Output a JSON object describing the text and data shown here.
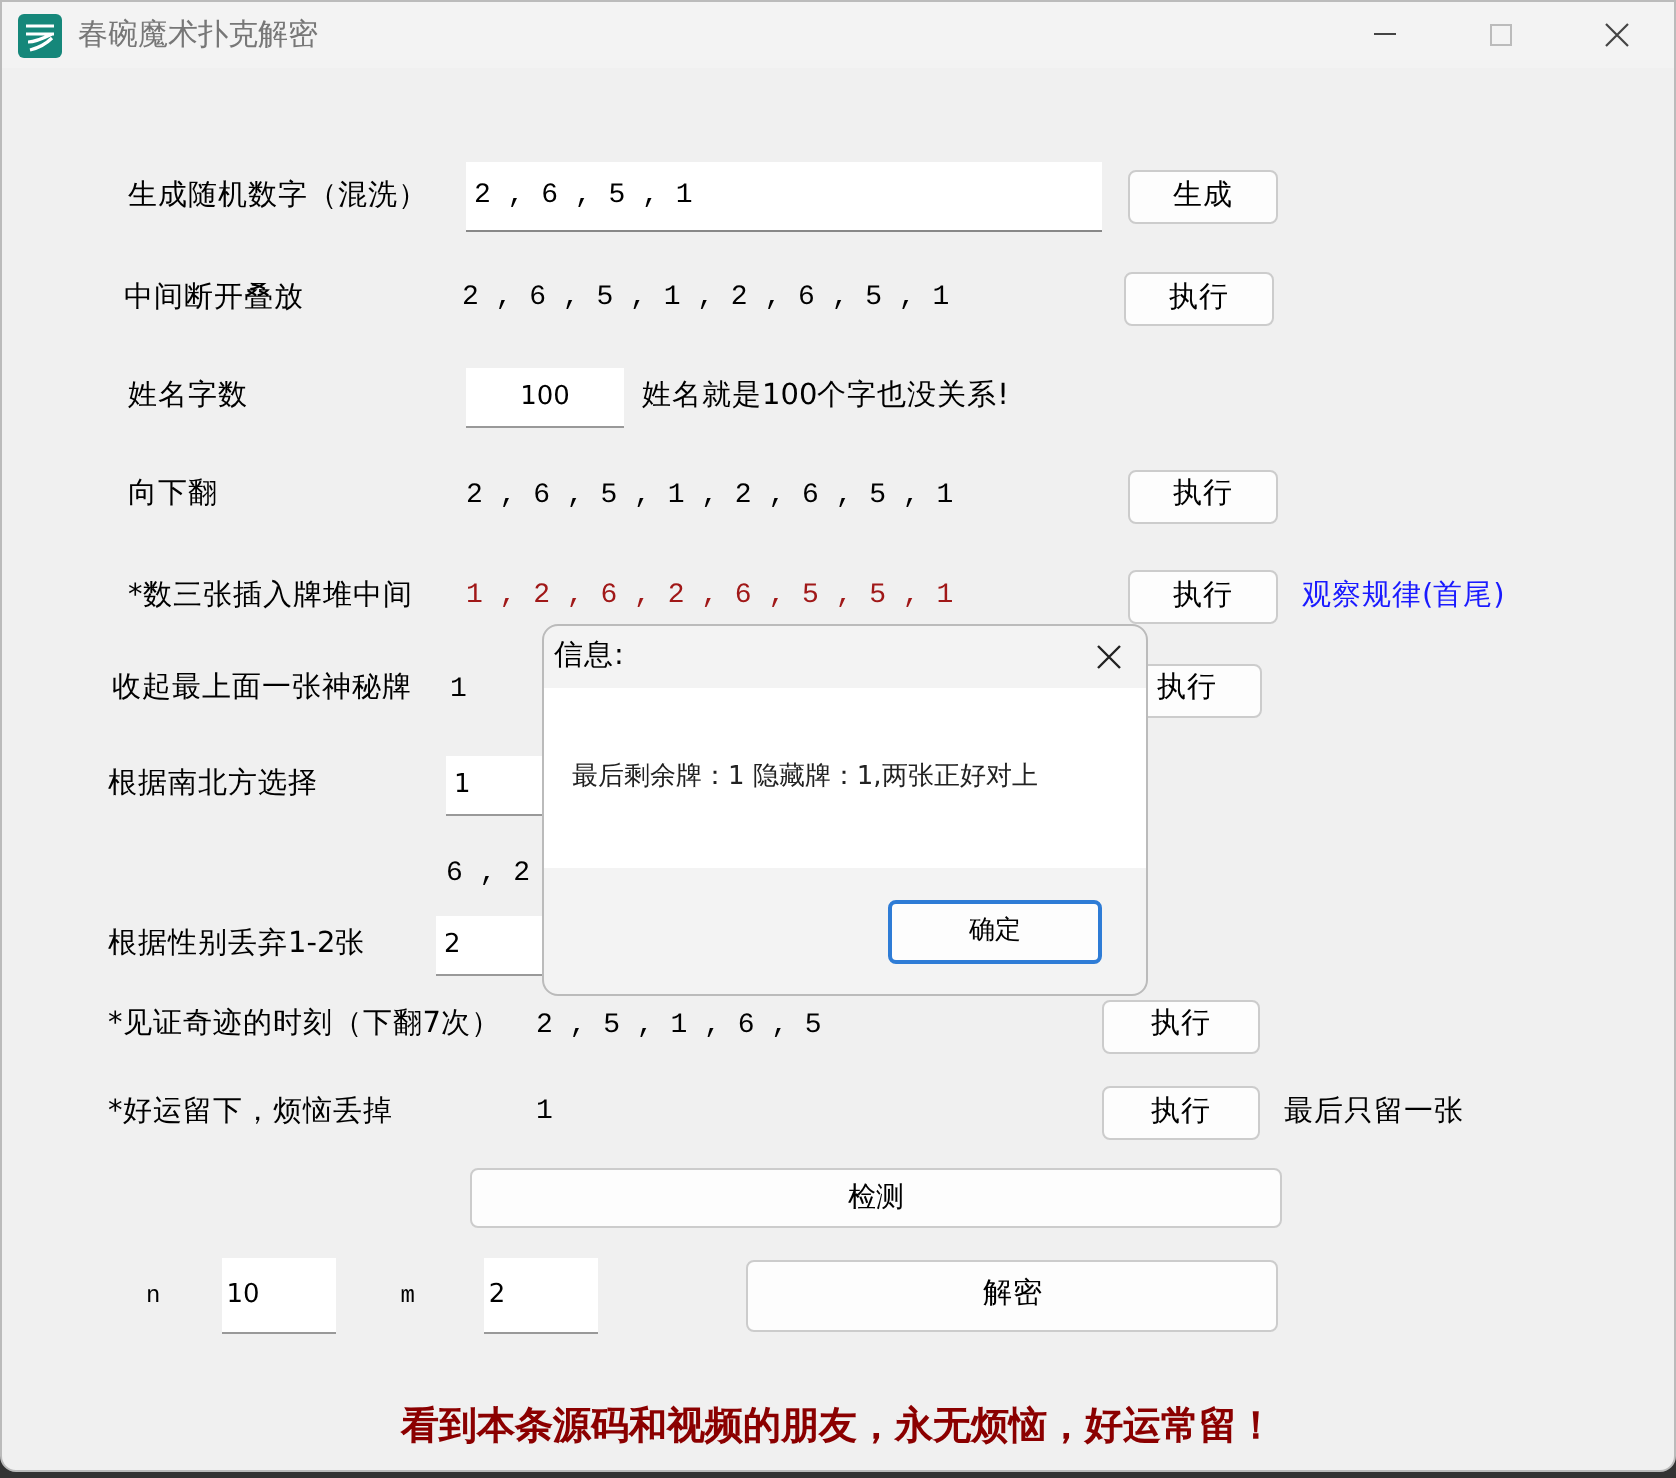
{
  "window": {
    "title": "春碗魔术扑克解密"
  },
  "steps": [
    {
      "label": "生成随机数字（混洗）",
      "kind": "field",
      "value": "2 , 6 , 5 , 1",
      "button": "生成"
    },
    {
      "label": "中间断开叠放",
      "kind": "text",
      "value": "2 , 6 , 5 , 1 , 2 , 6 , 5 , 1",
      "button": "执行"
    },
    {
      "label": "姓名字数",
      "kind": "small-field",
      "value": "100",
      "note": "姓名就是100个字也没关系!"
    },
    {
      "label": "向下翻",
      "kind": "text",
      "value": "2 , 6 , 5 , 1 , 2 , 6 , 5 , 1",
      "button": "执行"
    },
    {
      "label": "*数三张插入牌堆中间",
      "kind": "text",
      "value": "1 , 2 , 6 , 2 , 6 , 5 , 5 , 1",
      "emphasis": true,
      "button": "执行",
      "note": "观察规律(首尾)",
      "note_link": true
    },
    {
      "label": "收起最上面一张神秘牌",
      "kind": "text",
      "value": "1",
      "button": "执行"
    },
    {
      "label": "根据南北方选择",
      "kind": "small-field",
      "value": "1"
    },
    {
      "kind": "text",
      "value": "6 , 2"
    },
    {
      "label": "根据性别丢弃1-2张",
      "kind": "small-field",
      "value": "2"
    },
    {
      "label": "*见证奇迹的时刻（下翻7次）",
      "kind": "text",
      "value": "2 , 5 , 1 , 6 , 5",
      "button": "执行"
    },
    {
      "label": "*好运留下，烦恼丢掉",
      "kind": "text",
      "value": "1",
      "button": "执行",
      "note": "最后只留一张"
    }
  ],
  "check_button": "检测",
  "decode": {
    "n_label": "n",
    "n_value": "10",
    "m_label": "m",
    "m_value": "2",
    "button": "解密"
  },
  "footer": "看到本条源码和视频的朋友，永无烦恼，好运常留！",
  "dialog": {
    "title": "信息:",
    "message": "最后剩余牌：1 隐藏牌：1,两张正好对上",
    "button": "确定"
  }
}
